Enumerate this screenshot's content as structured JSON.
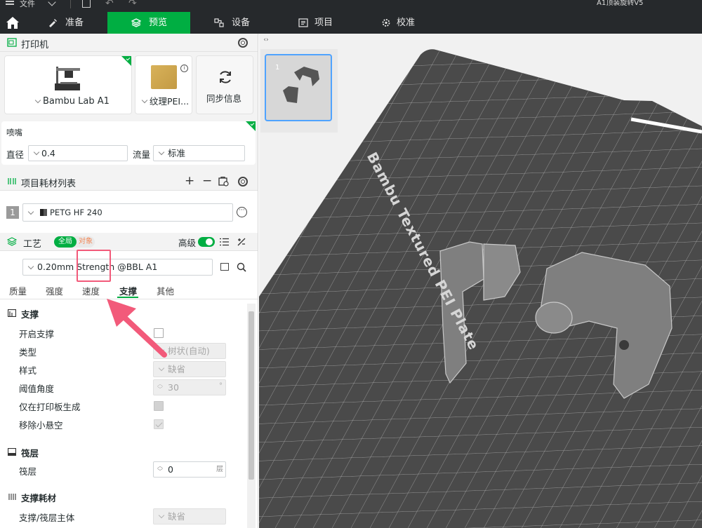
{
  "titlebar": {
    "file_menu": "文件",
    "document_title": "A1顶装旋转V5"
  },
  "tabs": [
    {
      "label": "准备",
      "active": false
    },
    {
      "label": "预览",
      "active": true
    },
    {
      "label": "设备",
      "active": false
    },
    {
      "label": "项目",
      "active": false
    },
    {
      "label": "校准",
      "active": false
    }
  ],
  "printer": {
    "section_title": "打印机",
    "printer_name": "Bambu Lab A1",
    "plate_name": "纹理PEI...",
    "sync_label": "同步信息",
    "nozzle_title": "喷嘴",
    "diameter_label": "直径",
    "diameter_value": "0.4",
    "flow_label": "流量",
    "flow_value": "标准"
  },
  "filament": {
    "section_title": "项目耗材列表",
    "slot_number": "1",
    "filament_name": "PETG HF 240"
  },
  "process": {
    "section_title": "工艺",
    "global_label": "全局",
    "object_label": "对象",
    "advanced_label": "高级",
    "preset_value": "0.20mm Strength @BBL A1",
    "tabs": [
      "质量",
      "强度",
      "速度",
      "支撑",
      "其他"
    ],
    "active_tab": "支撑"
  },
  "support": {
    "title": "支撑",
    "enable_label": "开启支撑",
    "type_label": "类型",
    "type_value": "树状(自动)",
    "style_label": "样式",
    "style_value": "缺省",
    "threshold_label": "阈值角度",
    "threshold_value": "30",
    "threshold_unit": "°",
    "plate_only_label": "仅在打印板生成",
    "remove_small_label": "移除小悬空"
  },
  "raft": {
    "title": "筏层",
    "layers_label": "筏层",
    "layers_value": "0",
    "layers_unit": "层"
  },
  "support_filament": {
    "title": "支撑耗材",
    "base_label": "支撑/筏层主体",
    "base_value": "缺省"
  },
  "plate": {
    "thumbnail_index": "1",
    "bed_label": "Bambu Textured PEI Plate"
  },
  "colors": {
    "accent": "#00ae42",
    "annotation": "#f25a7a",
    "dark_bar": "#26292c",
    "bed": "#4a4a4a"
  }
}
